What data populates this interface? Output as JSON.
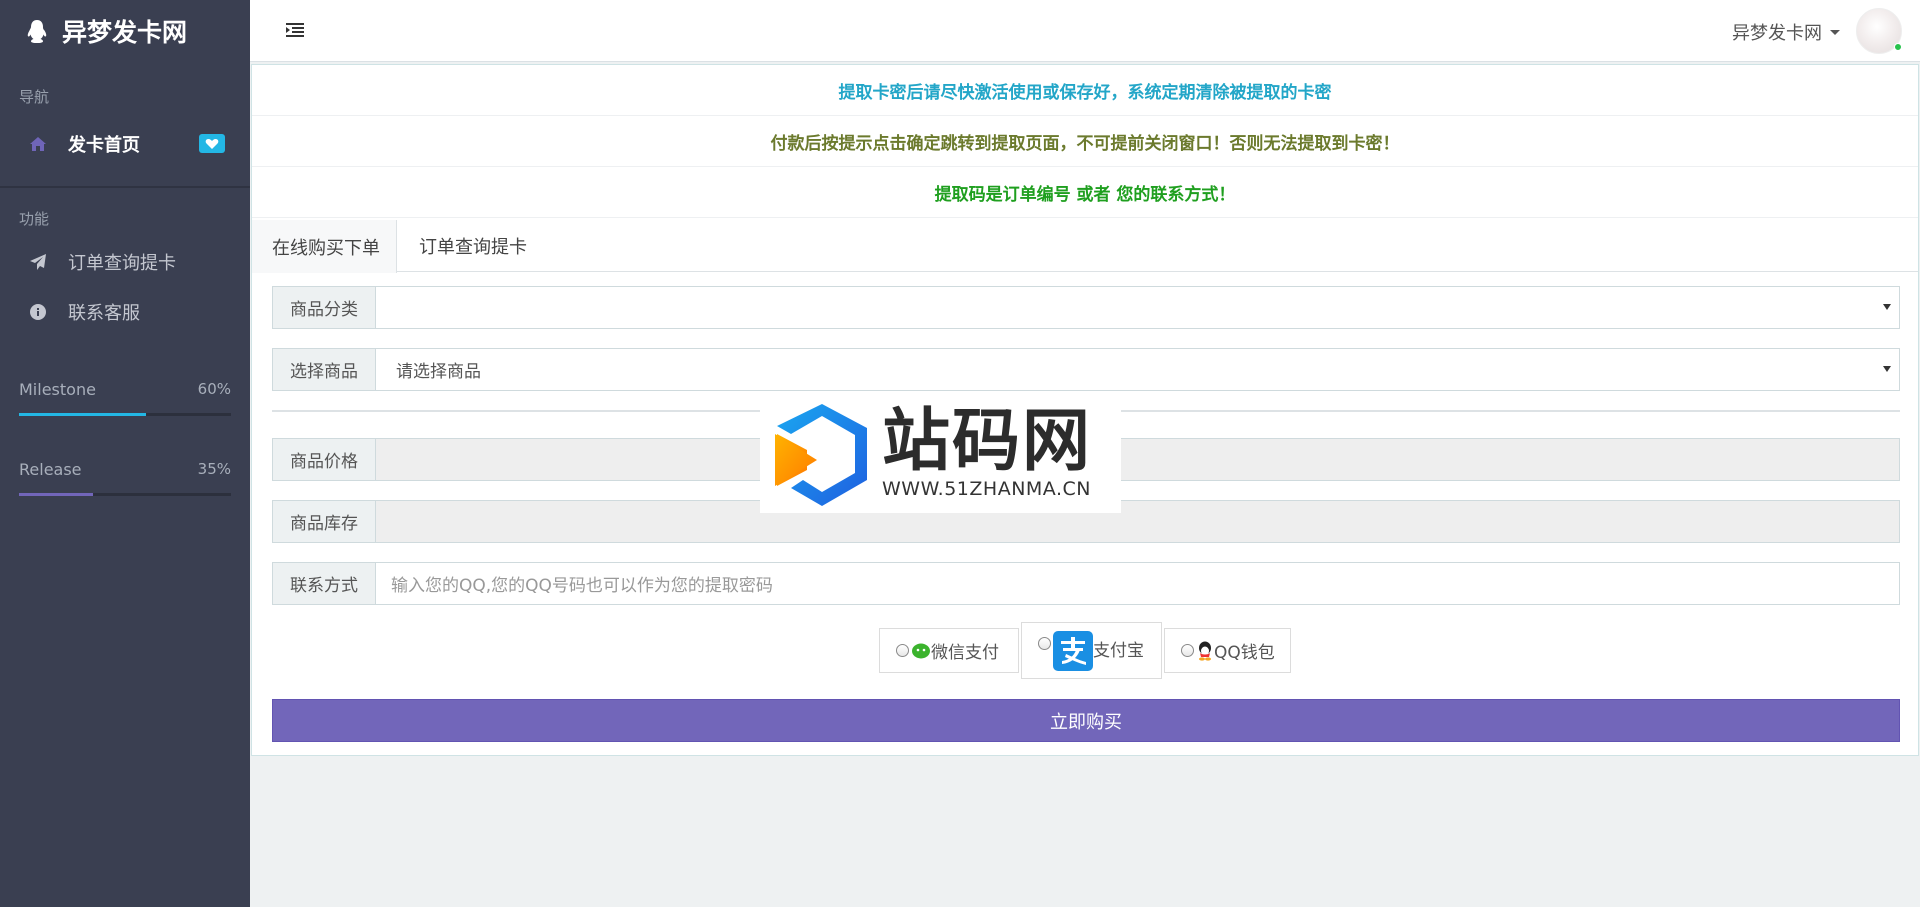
{
  "brand": {
    "title": "异梦发卡网",
    "icon": "qq-penguin-icon"
  },
  "sidebar": {
    "nav_heading": "导航",
    "home": {
      "label": "发卡首页",
      "icon": "home-icon",
      "badge_icon": "heart-icon"
    },
    "func_heading": "功能",
    "items": [
      {
        "label": "订单查询提卡",
        "icon": "paper-plane-icon"
      },
      {
        "label": "联系客服",
        "icon": "info-circle-icon"
      }
    ],
    "progress": [
      {
        "label": "Milestone",
        "pct_text": "60%",
        "value": 0.6,
        "color": "#23b7e5"
      },
      {
        "label": "Release",
        "pct_text": "35%",
        "value": 0.35,
        "color": "#7266ba"
      }
    ]
  },
  "topbar": {
    "user_name": "异梦发卡网"
  },
  "notices": [
    {
      "text": "提取卡密后请尽快激活使用或保存好，系统定期清除被提取的卡密",
      "color": "#23a6c8"
    },
    {
      "text": "付款后按提示点击确定跳转到提取页面，不可提前关闭窗口！否则无法提取到卡密！",
      "color": "#6b7a2d"
    },
    {
      "text": "提取码是订单编号 或者 您的联系方式！",
      "color": "#1f9f1f"
    }
  ],
  "tabs": {
    "buy": "在线购买下单",
    "query": "订单查询提卡"
  },
  "form": {
    "category_label": "商品分类",
    "category_value": "",
    "product_label": "选择商品",
    "product_value": "请选择商品",
    "price_label": "商品价格",
    "price_value": "",
    "stock_label": "商品库存",
    "stock_value": "",
    "contact_label": "联系方式",
    "contact_placeholder": "输入您的QQ,您的QQ号码也可以作为您的提取密码"
  },
  "payments": [
    {
      "label": "微信支付",
      "icon": "wechat-icon"
    },
    {
      "label": "支付宝",
      "icon": "alipay-icon"
    },
    {
      "label": "QQ钱包",
      "icon": "qq-wallet-icon"
    }
  ],
  "buy_button": "立即购买",
  "watermark": {
    "text": "站码网",
    "url": "WWW.51ZHANMA.CN"
  },
  "colors": {
    "sidebar": "#3a3f51",
    "accent": "#7266ba",
    "info": "#23b7e5"
  }
}
